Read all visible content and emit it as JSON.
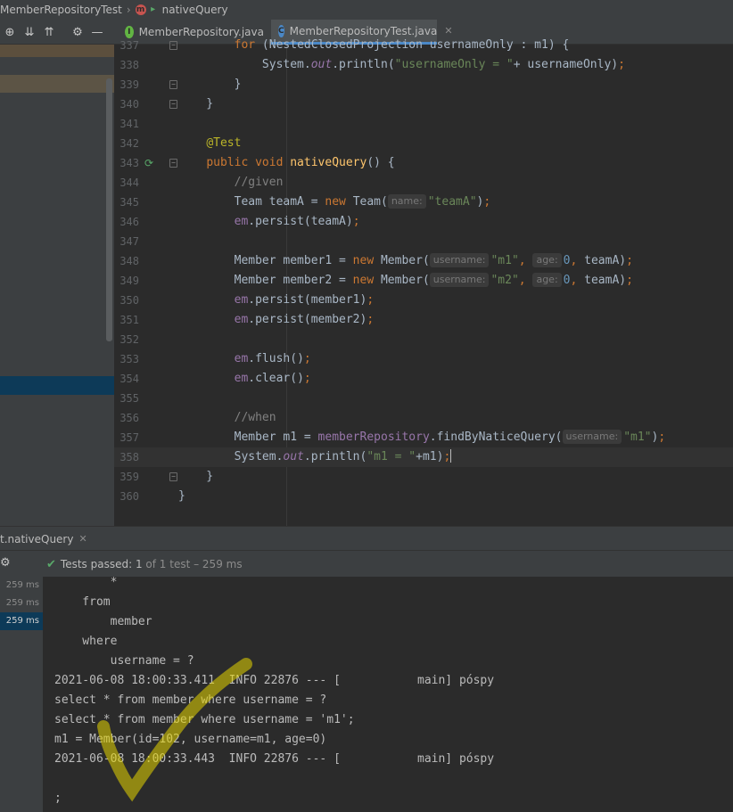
{
  "breadcrumb": {
    "items": [
      "MemberRepositoryTest",
      "nativeQuery"
    ],
    "icon_names": [
      "class-icon",
      "method-icon"
    ]
  },
  "tabs": [
    {
      "label": "MemberRepository.java",
      "icon": "interface-file-icon",
      "active": false
    },
    {
      "label": "MemberRepositoryTest.java",
      "icon": "class-file-icon",
      "active": true
    }
  ],
  "editor": {
    "lines": [
      {
        "n": "337",
        "html": "        <span class=\"kw\">for</span> (NestedClosedProjection usernameOnly : m1) {"
      },
      {
        "n": "338",
        "html": "            System.<span class=\"fld ital\">out</span>.println(<span class=\"str\">\"usernameOnly = \"</span>+ usernameOnly)<span class=\"kw\">;</span>"
      },
      {
        "n": "339",
        "html": "        }"
      },
      {
        "n": "340",
        "html": "    }"
      },
      {
        "n": "341",
        "html": ""
      },
      {
        "n": "342",
        "html": "    <span class=\"ann\">@Test</span>"
      },
      {
        "n": "343",
        "html": "    <span class=\"kw\">public void </span><span class=\"fn\">nativeQuery</span>() {"
      },
      {
        "n": "344",
        "html": "        <span class=\"cmt\">//given</span>"
      },
      {
        "n": "345",
        "html": "        Team teamA = <span class=\"kw\">new </span>Team(<span class=\"hint\">name:</span><span class=\"str\">\"teamA\"</span>)<span class=\"kw\">;</span>"
      },
      {
        "n": "346",
        "html": "        <span class=\"fld\">em</span>.persist(teamA)<span class=\"kw\">;</span>"
      },
      {
        "n": "347",
        "html": ""
      },
      {
        "n": "348",
        "html": "        Member member1 = <span class=\"kw\">new </span>Member(<span class=\"hint\">username:</span><span class=\"str\">\"m1\"</span><span class=\"kw\">, </span><span class=\"hint\">age:</span><span class=\"num\">0</span><span class=\"kw\">, </span>teamA)<span class=\"kw\">;</span>"
      },
      {
        "n": "349",
        "html": "        Member member2 = <span class=\"kw\">new </span>Member(<span class=\"hint\">username:</span><span class=\"str\">\"m2\"</span><span class=\"kw\">, </span><span class=\"hint\">age:</span><span class=\"num\">0</span><span class=\"kw\">, </span>teamA)<span class=\"kw\">;</span>"
      },
      {
        "n": "350",
        "html": "        <span class=\"fld\">em</span>.persist(member1)<span class=\"kw\">;</span>"
      },
      {
        "n": "351",
        "html": "        <span class=\"fld\">em</span>.persist(member2)<span class=\"kw\">;</span>"
      },
      {
        "n": "352",
        "html": ""
      },
      {
        "n": "353",
        "html": "        <span class=\"fld\">em</span>.flush()<span class=\"kw\">;</span>"
      },
      {
        "n": "354",
        "html": "        <span class=\"fld\">em</span>.clear()<span class=\"kw\">;</span>"
      },
      {
        "n": "355",
        "html": ""
      },
      {
        "n": "356",
        "html": "        <span class=\"cmt\">//when</span>"
      },
      {
        "n": "357",
        "html": "        Member m1 = <span class=\"fld\">memberRepository</span>.findByNaticeQuery(<span class=\"hint\">username:</span><span class=\"str\">\"m1\"</span>)<span class=\"kw\">;</span>"
      },
      {
        "n": "358",
        "html": "        System.<span class=\"fld ital\">out</span>.println(<span class=\"str\">\"m1 = \"</span>+m1)<span class=\"kw\">;</span><span class=\"caret\"></span>"
      },
      {
        "n": "359",
        "html": "    }"
      },
      {
        "n": "360",
        "html": "}"
      }
    ],
    "current_line": "358",
    "run_line": "343",
    "fold_lines": [
      "337",
      "339",
      "340",
      "343",
      "359"
    ]
  },
  "run_panel": {
    "tab_label": "t.nativeQuery",
    "status_prefix": "Tests passed:",
    "status_count": "1",
    "status_suffix": "of 1 test – 259 ms",
    "tree_times": [
      "259 ms",
      "259 ms",
      "259 ms"
    ],
    "selected_index": 2
  },
  "console": {
    "lines": [
      "        *",
      "    from",
      "        member",
      "    where",
      "        username = ?",
      "2021-06-08 18:00:33.411  INFO 22876 --- [           main] póspy",
      "select * from member where username = ?",
      "select * from member where username = 'm1';",
      "m1 = Member(id=102, username=m1, age=0)",
      "2021-06-08 18:00:33.443  INFO 22876 --- [           main] póspy",
      "",
      ";",
      "                                        [                ]"
    ]
  },
  "colors": {
    "background": "#2b2b2b",
    "panel": "#3c3f41",
    "keyword": "#cc7832",
    "string": "#6a8759",
    "annotation": "#bbb529",
    "field": "#9876aa",
    "success": "#59a869",
    "selection": "#0d3a58",
    "marker_highlight": "#e6d600"
  }
}
